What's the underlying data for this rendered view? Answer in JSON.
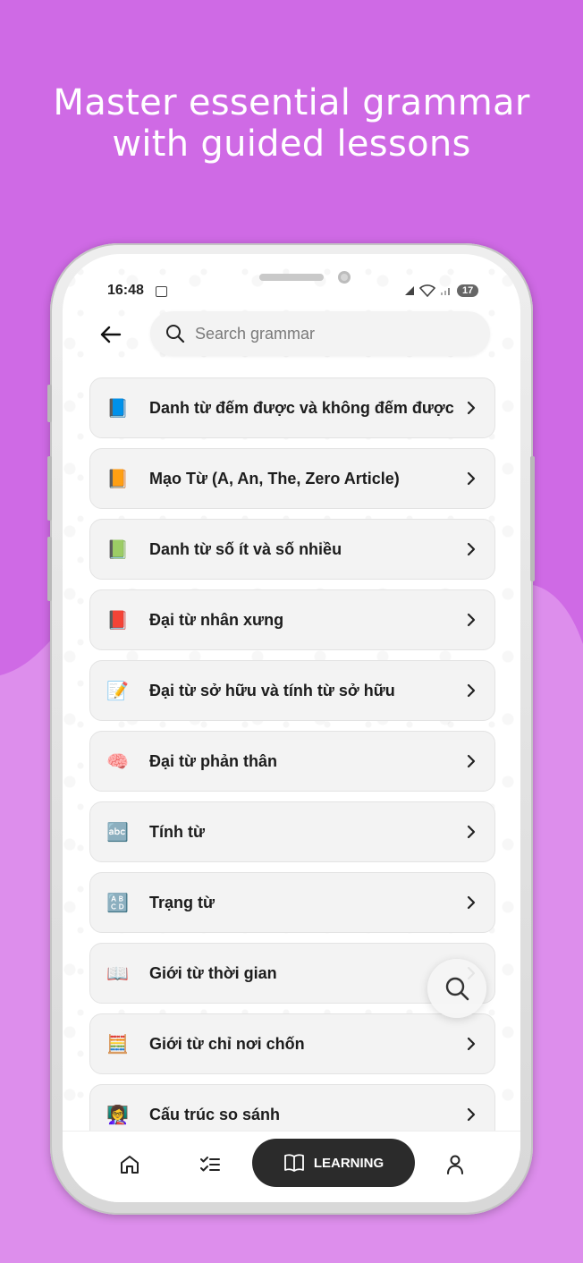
{
  "headline": {
    "line1": "Master essential grammar",
    "line2": "with guided lessons"
  },
  "status_bar": {
    "time": "16:48",
    "battery": "17"
  },
  "search": {
    "placeholder": "Search grammar"
  },
  "lessons": [
    {
      "emoji": "📘",
      "label": "Danh từ đếm được và không đếm được"
    },
    {
      "emoji": "📙",
      "label": "Mạo Từ (A, An, The, Zero Article)"
    },
    {
      "emoji": "📗",
      "label": "Danh từ số ít và số nhiều"
    },
    {
      "emoji": "📕",
      "label": "Đại từ nhân xưng"
    },
    {
      "emoji": "📝",
      "label": "Đại từ sở hữu và tính từ sở hữu"
    },
    {
      "emoji": "🧠",
      "label": "Đại từ phản thân"
    },
    {
      "emoji": "🔤",
      "label": "Tính từ"
    },
    {
      "emoji": "🔠",
      "label": "Trạng từ"
    },
    {
      "emoji": "📖",
      "label": "Giới từ thời gian"
    },
    {
      "emoji": "🧮",
      "label": "Giới từ chỉ nơi chốn"
    },
    {
      "emoji": "👩‍🏫",
      "label": "Cấu trúc so sánh"
    }
  ],
  "bottom_nav": {
    "active_label": "LEARNING",
    "icons": [
      "home-icon",
      "checklist-icon",
      "book-icon",
      "profile-icon"
    ]
  },
  "colors": {
    "background": "#cf6ae5",
    "wave": "#dd8eec",
    "nav_pill": "#2b2b2b"
  }
}
